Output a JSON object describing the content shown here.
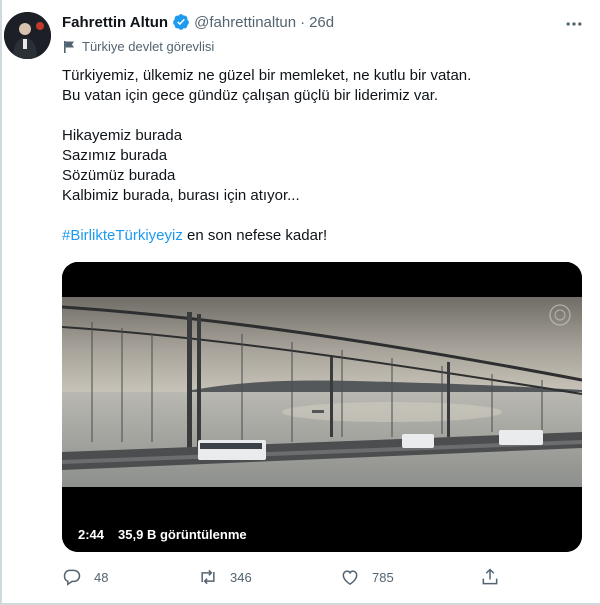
{
  "author": {
    "name": "Fahrettin Altun",
    "handle": "@fahrettinaltun",
    "separator": "·",
    "time": "26d",
    "account_label": "Türkiye devlet görevlisi"
  },
  "tweet": {
    "lines_1": [
      "Türkiyemiz, ülkemiz ne güzel bir memleket, ne kutlu bir vatan.",
      "Bu vatan için gece gündüz çalışan güçlü bir liderimiz var."
    ],
    "lines_2": [
      "Hikayemiz burada",
      "Sazımız burada",
      "Sözümüz burada",
      "Kalbimiz burada, burası için atıyor..."
    ],
    "hashtag": "#BirlikteTürkiyeyiz",
    "hashtag_tail": " en son nefese kadar!"
  },
  "video": {
    "duration": "2:44",
    "views": "35,9 B görüntülenme"
  },
  "actions": {
    "replies": "48",
    "retweets": "346",
    "likes": "785"
  },
  "colors": {
    "link": "#1d9bf0",
    "verified": "#1d9bf0",
    "secondary_text": "#536471"
  },
  "icons": [
    "verified-badge-icon",
    "more-icon",
    "government-flag-icon",
    "reply-icon",
    "retweet-icon",
    "like-icon",
    "share-icon"
  ]
}
